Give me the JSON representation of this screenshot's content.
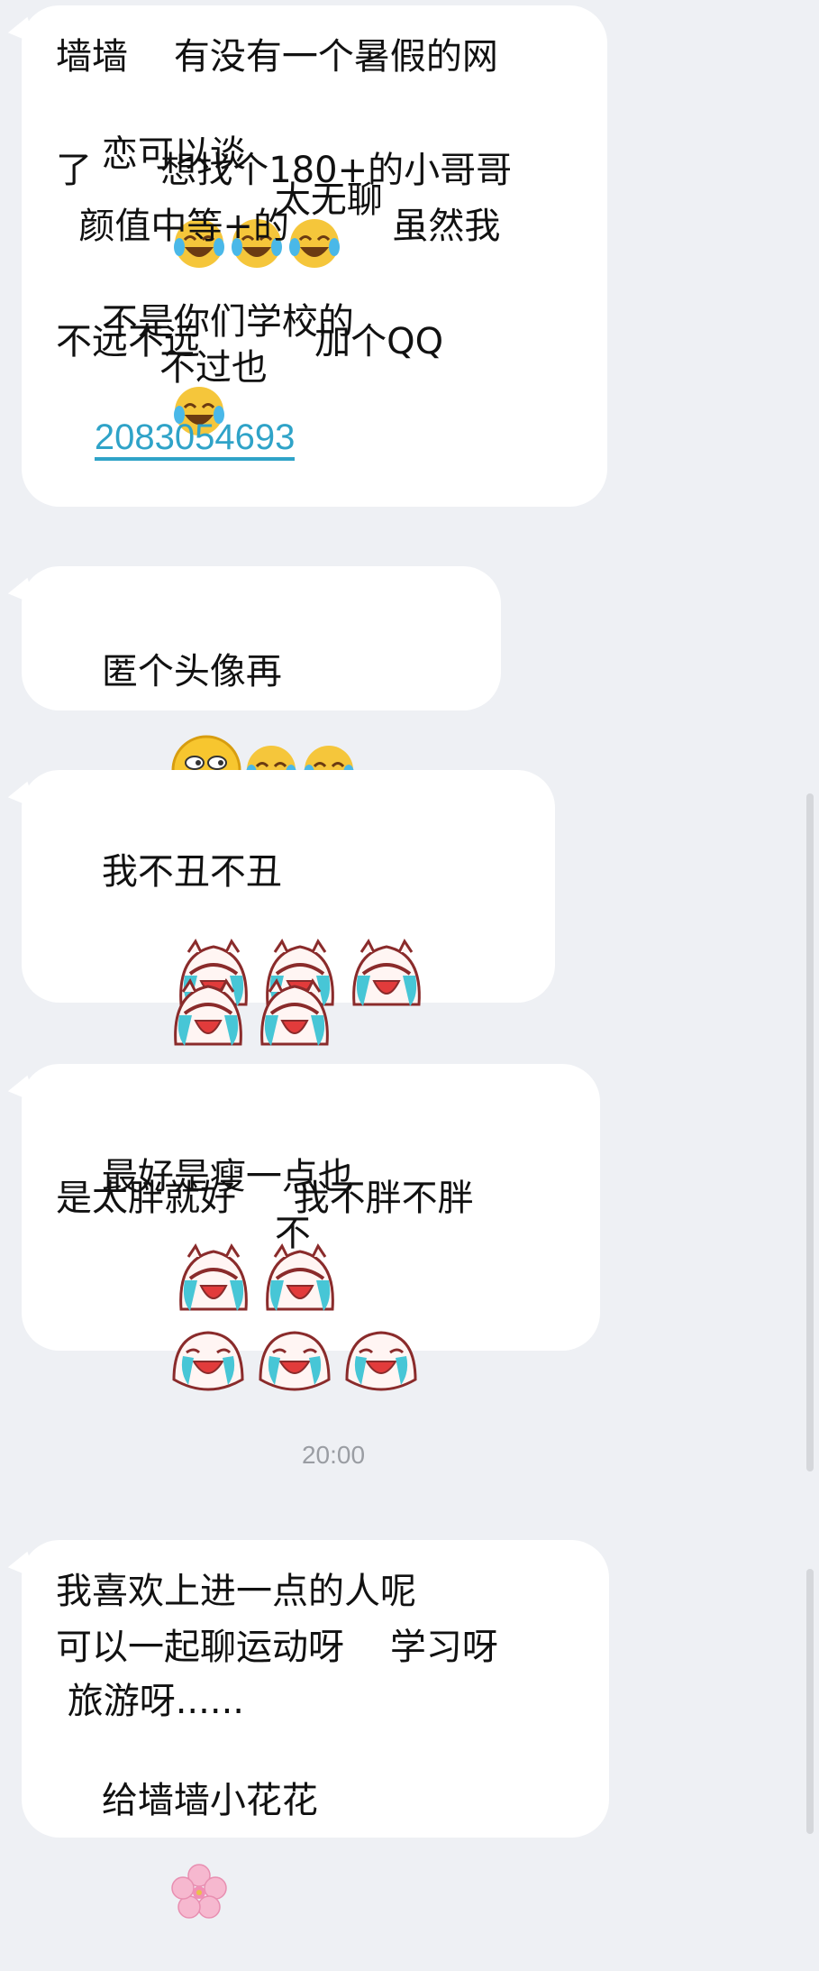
{
  "messages": [
    {
      "lines": [
        "墙墙    有没有一个暑假的网",
        "恋可以谈",
        "太无聊",
        "了      想找个180+的小哥哥",
        "  颜值中等+的         虽然我",
        "不是你们学校的",
        "不过也",
        "不远不远          加个QQ"
      ],
      "qq_number": "2083054693"
    },
    {
      "text": "匿个头像再"
    },
    {
      "text": "我不丑不丑"
    },
    {
      "lines": [
        "最好是瘦一点也",
        "不",
        "是太胖就好     我不胖不胖"
      ]
    },
    {
      "lines": [
        "我喜欢上进一点的人呢",
        "可以一起聊运动呀    学习呀",
        " 旅游呀......",
        "给墙墙小花花"
      ]
    }
  ],
  "timestamp": "20:00",
  "icons": [
    "laughing-crying-emoji",
    "grin-wink-emoji",
    "crying-cat-emoji",
    "cherry-blossom-emoji"
  ]
}
